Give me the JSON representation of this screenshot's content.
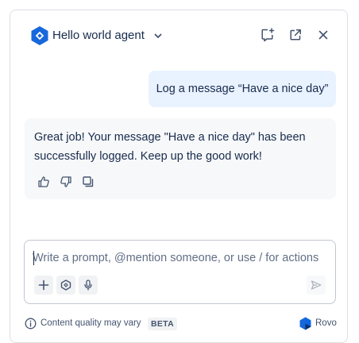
{
  "header": {
    "agent_name": "Hello world agent",
    "icons": {
      "agent": "agent-logo-icon",
      "dropdown": "chevron-down-icon",
      "new_chat": "new-chat-icon",
      "open_fullscreen": "open-external-icon",
      "close": "close-icon"
    }
  },
  "conversation": {
    "user_message": "Log a message “Have a nice day”",
    "agent_message": "Great job! Your message \"Have a nice day\" has been successfully logged. Keep up the good work!",
    "actions": [
      "thumbs-up-icon",
      "thumbs-down-icon",
      "copy-icon"
    ]
  },
  "composer": {
    "value": "",
    "placeholder": "Write a prompt, @mention someone, or use / for actions",
    "buttons": [
      "plus-icon",
      "agent-icon",
      "microphone-icon",
      "send-icon"
    ]
  },
  "footer": {
    "disclaimer": "Content quality may vary",
    "badge": "BETA",
    "brand": "Rovo"
  },
  "colors": {
    "accent": "#1868db",
    "user_bubble": "#e9f2ff",
    "agent_bubble": "#f7f8f9",
    "text": "#172b4d"
  }
}
